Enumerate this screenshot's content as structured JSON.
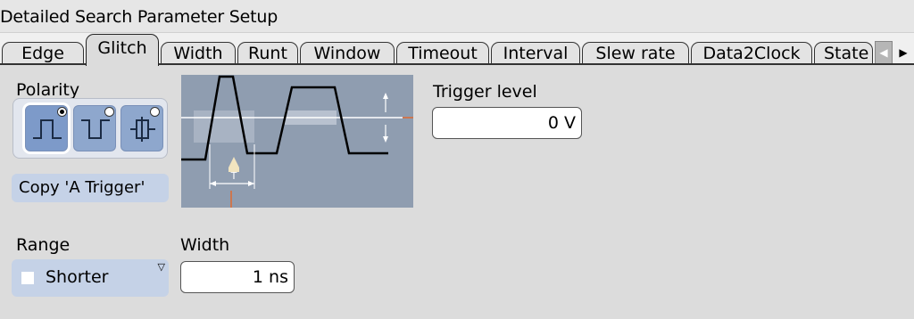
{
  "window": {
    "title": "Detailed Search Parameter Setup"
  },
  "tabs": [
    {
      "label": "Edge"
    },
    {
      "label": "Glitch"
    },
    {
      "label": "Width"
    },
    {
      "label": "Runt"
    },
    {
      "label": "Window"
    },
    {
      "label": "Timeout"
    },
    {
      "label": "Interval"
    },
    {
      "label": "Slew rate"
    },
    {
      "label": "Data2Clock"
    },
    {
      "label": "State"
    }
  ],
  "active_tab": "Glitch",
  "tab_scroll": {
    "left_icon": "triangle-left-icon",
    "right_icon": "triangle-right-icon"
  },
  "polarity": {
    "label": "Polarity",
    "options": [
      {
        "name": "positive-pulse-icon",
        "selected": true
      },
      {
        "name": "negative-pulse-icon",
        "selected": false
      },
      {
        "name": "either-pulse-icon",
        "selected": false
      }
    ]
  },
  "copy_button": {
    "label": "Copy 'A Trigger'"
  },
  "diagram": {
    "width_marker": "T"
  },
  "trigger_level": {
    "label": "Trigger level",
    "value": "0 V"
  },
  "range": {
    "label": "Range",
    "value": "Shorter"
  },
  "width": {
    "label": "Width",
    "value": "1 ns"
  },
  "colors": {
    "panel_bg": "#dcdcdc",
    "button_blue": "#c5d2e7",
    "diagram_bg": "#8f9db0",
    "level_marker": "#e06a30"
  }
}
